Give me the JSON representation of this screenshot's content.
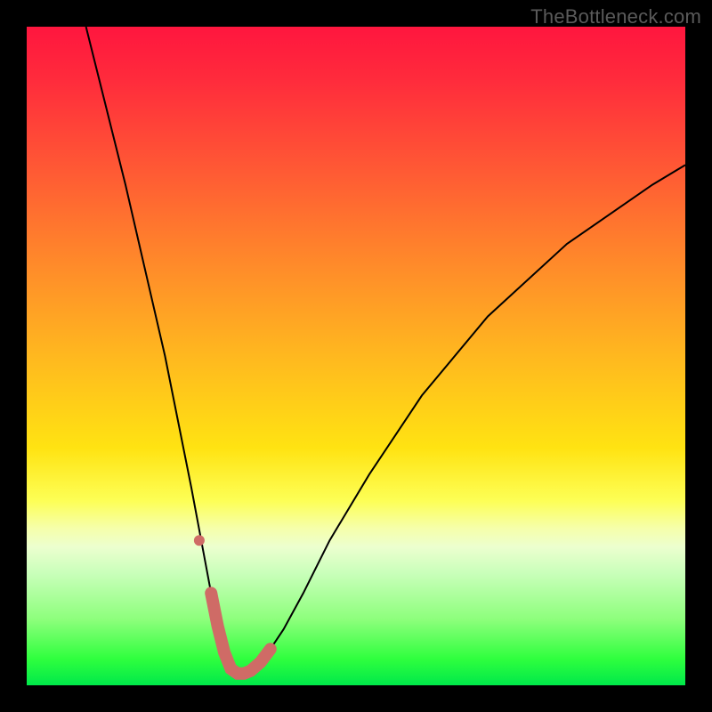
{
  "credit_text": "TheBottleneck.com",
  "chart_data": {
    "type": "line",
    "title": "",
    "xlabel": "",
    "ylabel": "",
    "xlim": [
      0,
      100
    ],
    "ylim": [
      0,
      100
    ],
    "grid": false,
    "legend": false,
    "series": [
      {
        "name": "bottleneck-curve",
        "stroke": "#000000",
        "stroke_width": 2,
        "x": [
          9,
          12,
          15,
          18,
          21,
          23,
          25,
          26.5,
          28,
          29,
          30,
          31,
          32,
          33,
          34,
          35.5,
          37,
          39,
          42,
          46,
          52,
          60,
          70,
          82,
          95,
          100
        ],
        "values": [
          100,
          88,
          76,
          63,
          50,
          40,
          30,
          22,
          14,
          9,
          5,
          2.5,
          1.8,
          1.8,
          2.2,
          3.5,
          5.5,
          8.5,
          14,
          22,
          32,
          44,
          56,
          67,
          76,
          79
        ]
      },
      {
        "name": "bottom-marker-arc",
        "stroke": "#cf6b66",
        "stroke_width": 12,
        "linecap": "round",
        "x": [
          28,
          29,
          30,
          31,
          32,
          33,
          34,
          35.5,
          37
        ],
        "values": [
          14,
          9,
          5,
          2.5,
          1.8,
          1.8,
          2.2,
          3.5,
          5.5
        ]
      }
    ],
    "markers": [
      {
        "name": "left-dot",
        "x": 26.2,
        "y": 22,
        "r": 6,
        "fill": "#cf6b66"
      }
    ],
    "background_gradient": {
      "direction": "vertical",
      "stops": [
        {
          "pos": 0.0,
          "color": "#ff163e"
        },
        {
          "pos": 0.36,
          "color": "#ff8a2a"
        },
        {
          "pos": 0.64,
          "color": "#ffe312"
        },
        {
          "pos": 0.83,
          "color": "#c9ffba"
        },
        {
          "pos": 1.0,
          "color": "#00e84a"
        }
      ]
    }
  }
}
